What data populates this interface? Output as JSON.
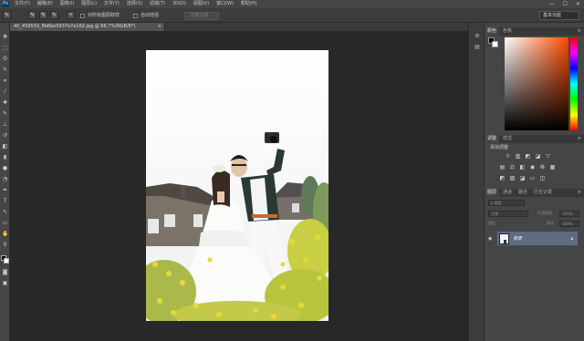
{
  "app": {
    "logo": "Ps"
  },
  "menubar": {
    "items": [
      "文件(F)",
      "编辑(E)",
      "图像(I)",
      "图层(L)",
      "文字(Y)",
      "选择(S)",
      "滤镜(T)",
      "3D(D)",
      "视图(V)",
      "窗口(W)",
      "帮助(H)"
    ],
    "window_controls": [
      "—",
      "☐",
      "✕"
    ]
  },
  "options_bar": {
    "sample_all_layers": "对所有图层取样",
    "auto_enhance": "自动增强",
    "refine_edge": "调整边缘...",
    "workspace": "基本功能"
  },
  "document": {
    "tab_title": "40_459550_8b6be5937e7e162.jpg @ 66.7%(RGB/8*)",
    "close": "×"
  },
  "panels": {
    "color_tabs": [
      "颜色",
      "色板"
    ],
    "adjust_tabs": [
      "调整",
      "样式"
    ],
    "add_adjustment": "添加调整",
    "layer_tabs": [
      "图层",
      "通道",
      "路径",
      "历史记录"
    ],
    "kind_filter": "ρ 类型",
    "blend_mode": "正常",
    "opacity_label": "不透明度",
    "opacity_value": "100%",
    "lock_label": "锁定",
    "fill_label": "填充",
    "fill_value": "100%",
    "layer_name": "背景",
    "menu_glyph": "≡"
  },
  "colors": {
    "fg": "#000000",
    "bg": "#ffffff",
    "accent_color": "#ff4a00"
  }
}
